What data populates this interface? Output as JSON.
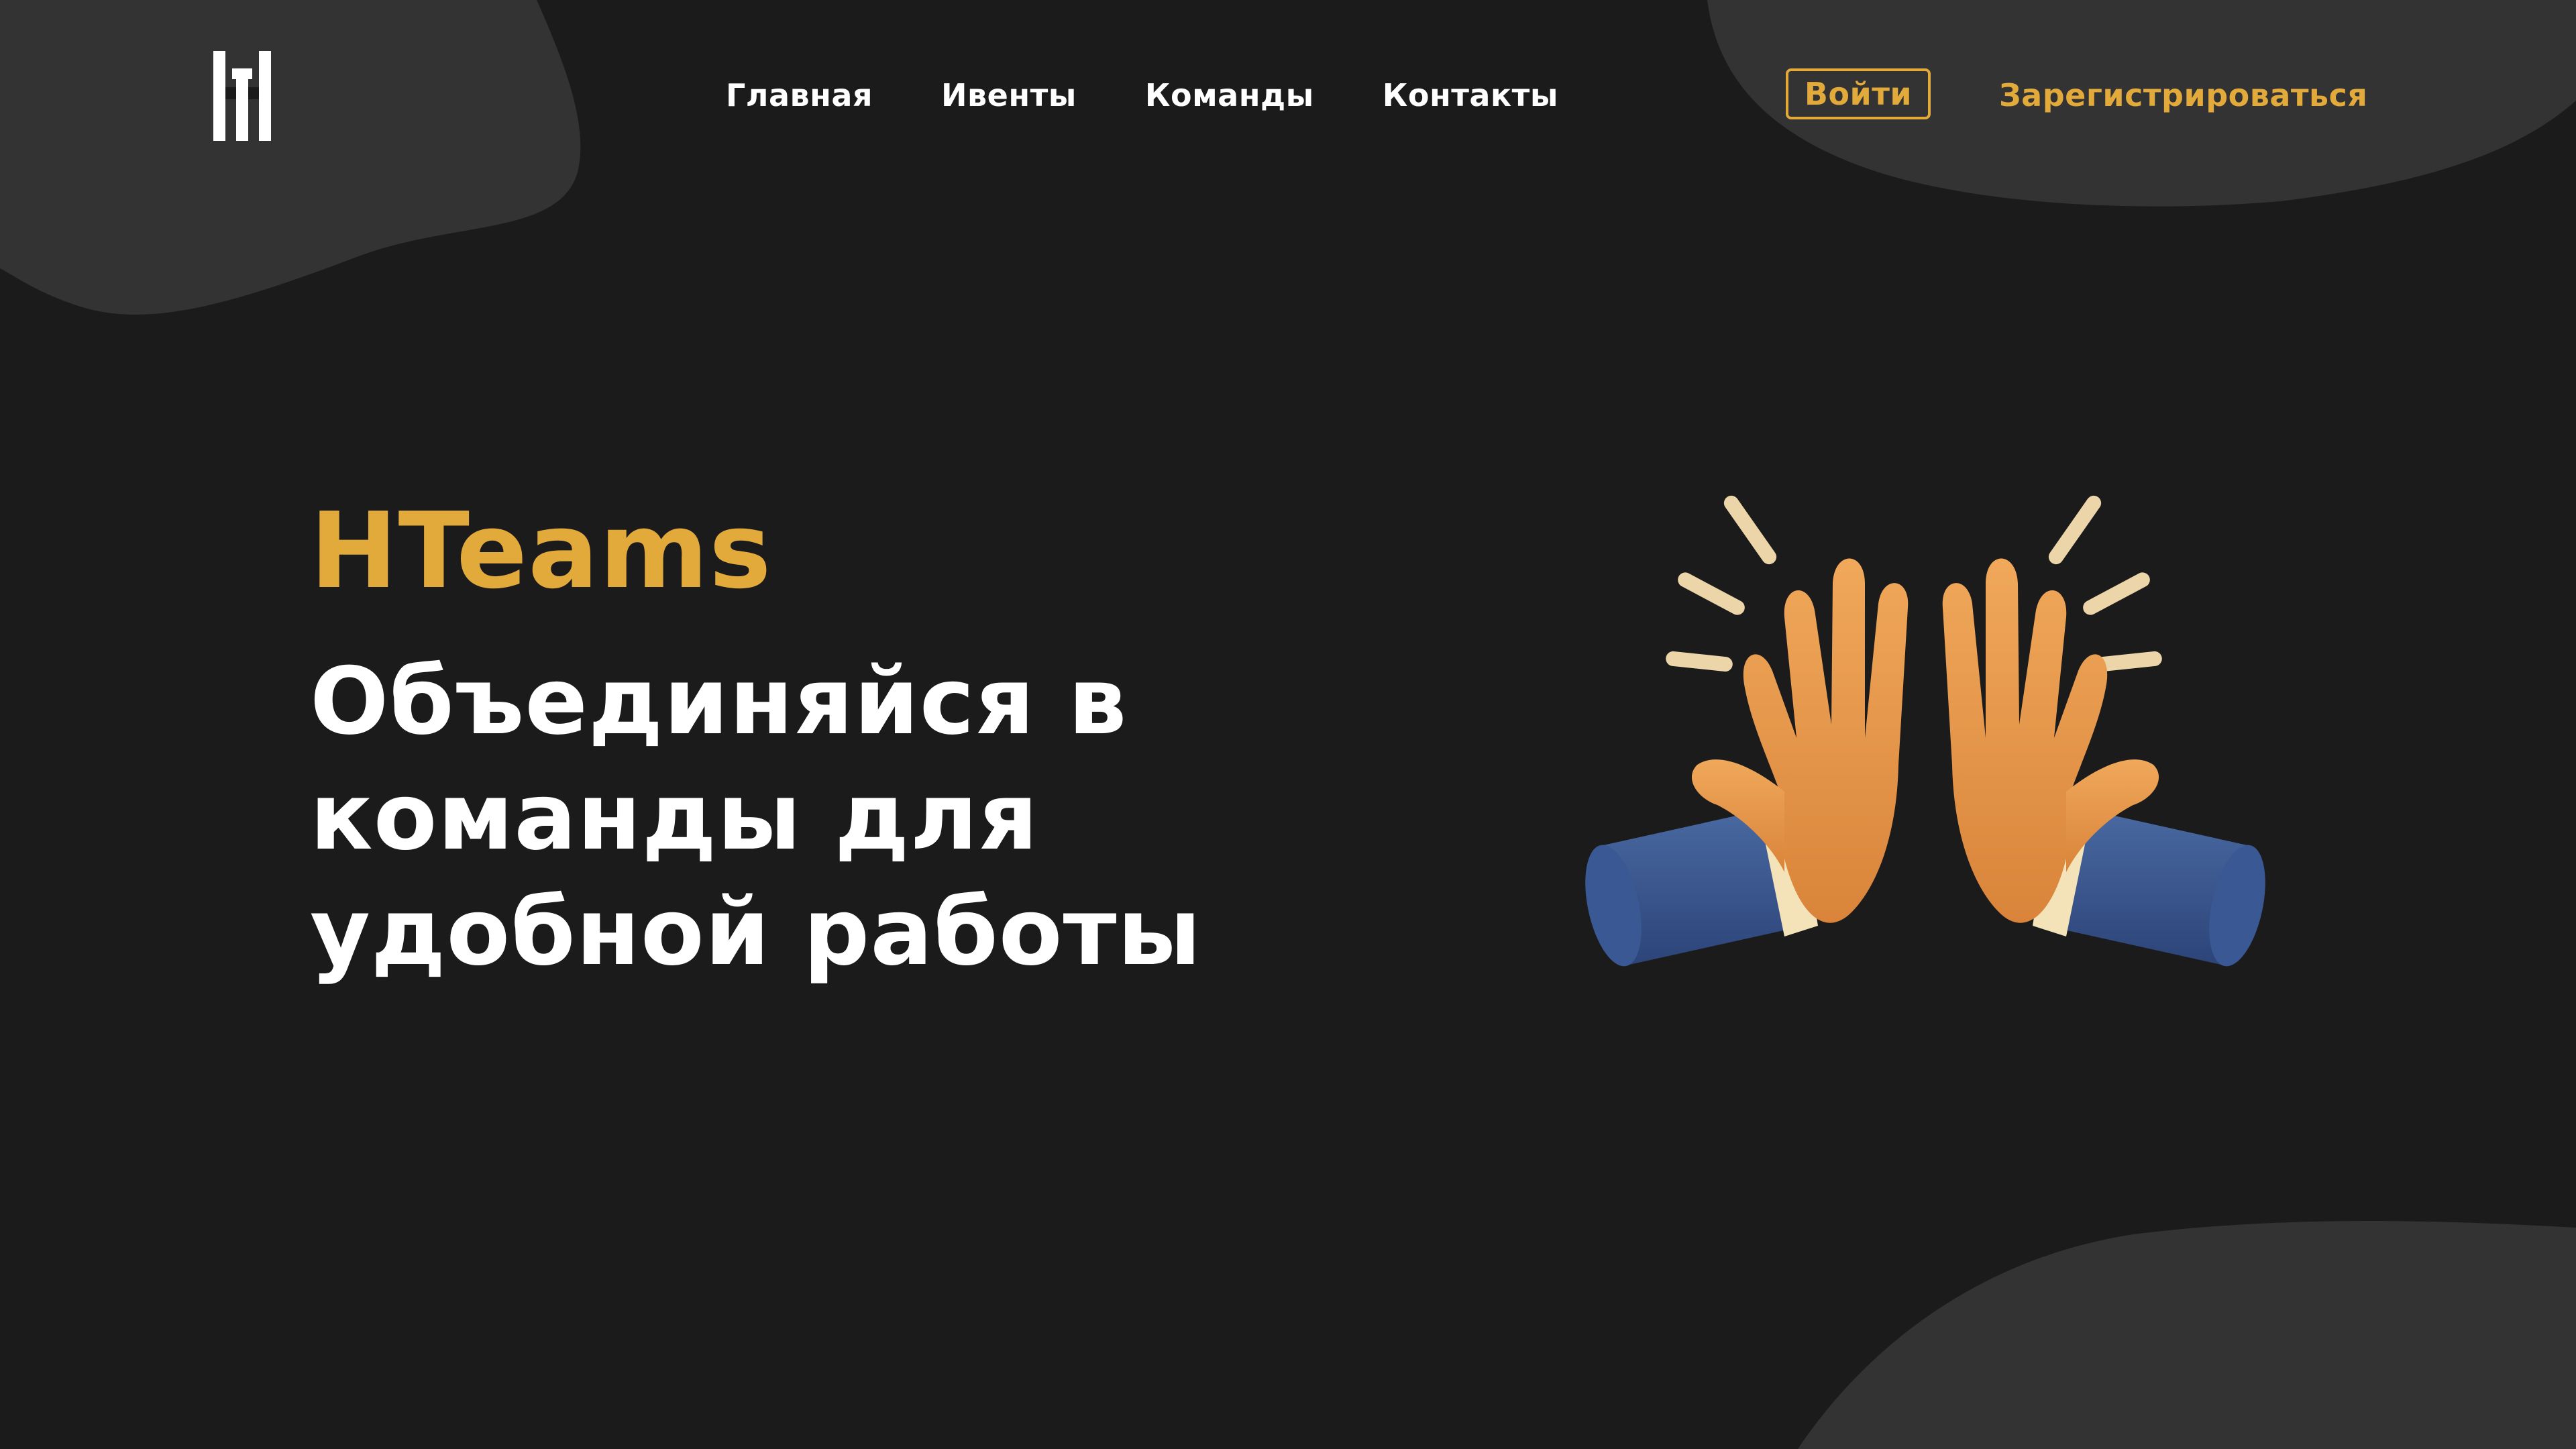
{
  "brand_logo": "HT-logo",
  "colors": {
    "background": "#1b1b1c",
    "blob": "#333334",
    "accent": "#e2a93b",
    "text": "#ffffff",
    "sleeve": "#3d5a8e",
    "skin": "#e89a4a"
  },
  "nav": {
    "items": [
      {
        "label": "Главная"
      },
      {
        "label": "Ивенты"
      },
      {
        "label": "Команды"
      },
      {
        "label": "Контакты"
      }
    ]
  },
  "auth": {
    "login_label": "Войти",
    "register_label": "Зарегистрироваться"
  },
  "hero": {
    "brand": "HTeams",
    "headline": "Объединяйся в команды для удобной работы"
  },
  "illustration": {
    "icon": "high-five-icon"
  }
}
